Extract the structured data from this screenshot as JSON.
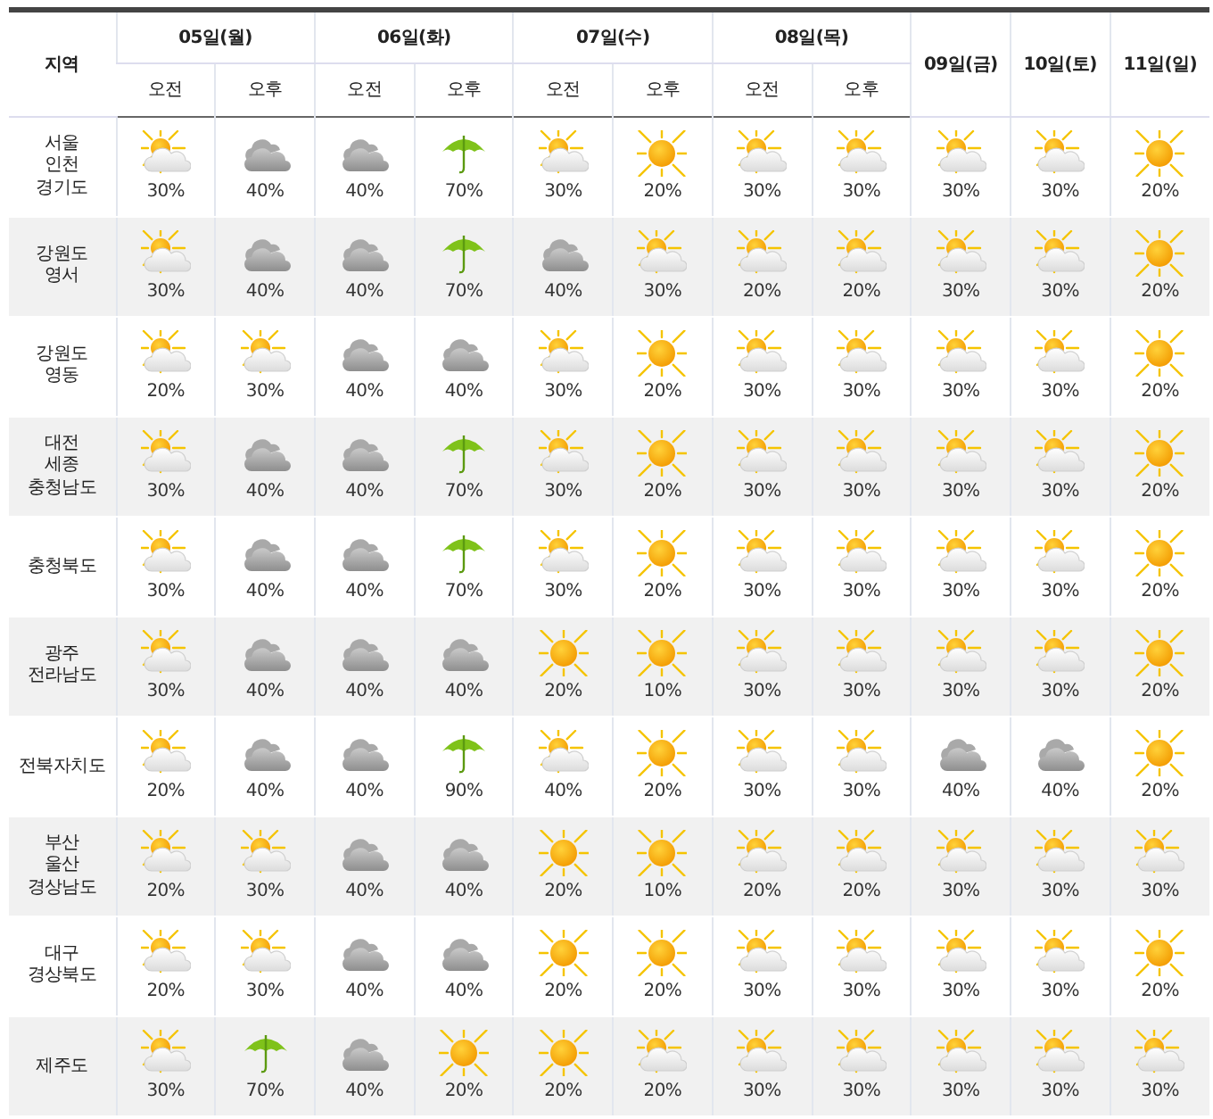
{
  "table": {
    "region_heading": "지역",
    "columns": [
      {
        "day": "05일(월)",
        "periods": [
          "오전",
          "오후"
        ]
      },
      {
        "day": "06일(화)",
        "periods": [
          "오전",
          "오후"
        ]
      },
      {
        "day": "07일(수)",
        "periods": [
          "오전",
          "오후"
        ]
      },
      {
        "day": "08일(목)",
        "periods": [
          "오전",
          "오후"
        ]
      },
      {
        "day": "09일(금)"
      },
      {
        "day": "10일(토)"
      },
      {
        "day": "11일(일)"
      }
    ],
    "rows": [
      {
        "region": "서울\n인천\n경기도",
        "forecasts": [
          {
            "kind": "partly",
            "chance": "30%"
          },
          {
            "kind": "cloudy",
            "chance": "40%"
          },
          {
            "kind": "cloudy",
            "chance": "40%"
          },
          {
            "kind": "rain",
            "chance": "70%"
          },
          {
            "kind": "partly",
            "chance": "30%"
          },
          {
            "kind": "sunny",
            "chance": "20%"
          },
          {
            "kind": "partly",
            "chance": "30%"
          },
          {
            "kind": "partly",
            "chance": "30%"
          },
          {
            "kind": "partly",
            "chance": "30%"
          },
          {
            "kind": "partly",
            "chance": "30%"
          },
          {
            "kind": "sunny",
            "chance": "20%"
          }
        ]
      },
      {
        "region": "강원도\n영서",
        "forecasts": [
          {
            "kind": "partly",
            "chance": "30%"
          },
          {
            "kind": "cloudy",
            "chance": "40%"
          },
          {
            "kind": "cloudy",
            "chance": "40%"
          },
          {
            "kind": "rain",
            "chance": "70%"
          },
          {
            "kind": "cloudy",
            "chance": "40%"
          },
          {
            "kind": "partly",
            "chance": "30%"
          },
          {
            "kind": "partly",
            "chance": "20%"
          },
          {
            "kind": "partly",
            "chance": "20%"
          },
          {
            "kind": "partly",
            "chance": "30%"
          },
          {
            "kind": "partly",
            "chance": "30%"
          },
          {
            "kind": "sunny",
            "chance": "20%"
          }
        ]
      },
      {
        "region": "강원도\n영동",
        "forecasts": [
          {
            "kind": "partly",
            "chance": "20%"
          },
          {
            "kind": "partly",
            "chance": "30%"
          },
          {
            "kind": "cloudy",
            "chance": "40%"
          },
          {
            "kind": "cloudy",
            "chance": "40%"
          },
          {
            "kind": "partly",
            "chance": "30%"
          },
          {
            "kind": "sunny",
            "chance": "20%"
          },
          {
            "kind": "partly",
            "chance": "30%"
          },
          {
            "kind": "partly",
            "chance": "30%"
          },
          {
            "kind": "partly",
            "chance": "30%"
          },
          {
            "kind": "partly",
            "chance": "30%"
          },
          {
            "kind": "sunny",
            "chance": "20%"
          }
        ]
      },
      {
        "region": "대전\n세종\n충청남도",
        "forecasts": [
          {
            "kind": "partly",
            "chance": "30%"
          },
          {
            "kind": "cloudy",
            "chance": "40%"
          },
          {
            "kind": "cloudy",
            "chance": "40%"
          },
          {
            "kind": "rain",
            "chance": "70%"
          },
          {
            "kind": "partly",
            "chance": "30%"
          },
          {
            "kind": "sunny",
            "chance": "20%"
          },
          {
            "kind": "partly",
            "chance": "30%"
          },
          {
            "kind": "partly",
            "chance": "30%"
          },
          {
            "kind": "partly",
            "chance": "30%"
          },
          {
            "kind": "partly",
            "chance": "30%"
          },
          {
            "kind": "sunny",
            "chance": "20%"
          }
        ]
      },
      {
        "region": "충청북도",
        "forecasts": [
          {
            "kind": "partly",
            "chance": "30%"
          },
          {
            "kind": "cloudy",
            "chance": "40%"
          },
          {
            "kind": "cloudy",
            "chance": "40%"
          },
          {
            "kind": "rain",
            "chance": "70%"
          },
          {
            "kind": "partly",
            "chance": "30%"
          },
          {
            "kind": "sunny",
            "chance": "20%"
          },
          {
            "kind": "partly",
            "chance": "30%"
          },
          {
            "kind": "partly",
            "chance": "30%"
          },
          {
            "kind": "partly",
            "chance": "30%"
          },
          {
            "kind": "partly",
            "chance": "30%"
          },
          {
            "kind": "sunny",
            "chance": "20%"
          }
        ]
      },
      {
        "region": "광주\n전라남도",
        "forecasts": [
          {
            "kind": "partly",
            "chance": "30%"
          },
          {
            "kind": "cloudy",
            "chance": "40%"
          },
          {
            "kind": "cloudy",
            "chance": "40%"
          },
          {
            "kind": "cloudy",
            "chance": "40%"
          },
          {
            "kind": "sunny",
            "chance": "20%"
          },
          {
            "kind": "sunny",
            "chance": "10%"
          },
          {
            "kind": "partly",
            "chance": "30%"
          },
          {
            "kind": "partly",
            "chance": "30%"
          },
          {
            "kind": "partly",
            "chance": "30%"
          },
          {
            "kind": "partly",
            "chance": "30%"
          },
          {
            "kind": "sunny",
            "chance": "20%"
          }
        ]
      },
      {
        "region": "전북자치도",
        "forecasts": [
          {
            "kind": "partly",
            "chance": "20%"
          },
          {
            "kind": "cloudy",
            "chance": "40%"
          },
          {
            "kind": "cloudy",
            "chance": "40%"
          },
          {
            "kind": "rain",
            "chance": "90%"
          },
          {
            "kind": "partly",
            "chance": "40%"
          },
          {
            "kind": "sunny",
            "chance": "20%"
          },
          {
            "kind": "partly",
            "chance": "30%"
          },
          {
            "kind": "partly",
            "chance": "30%"
          },
          {
            "kind": "cloudy",
            "chance": "40%"
          },
          {
            "kind": "cloudy",
            "chance": "40%"
          },
          {
            "kind": "sunny",
            "chance": "20%"
          }
        ]
      },
      {
        "region": "부산\n울산\n경상남도",
        "forecasts": [
          {
            "kind": "partly",
            "chance": "20%"
          },
          {
            "kind": "partly",
            "chance": "30%"
          },
          {
            "kind": "cloudy",
            "chance": "40%"
          },
          {
            "kind": "cloudy",
            "chance": "40%"
          },
          {
            "kind": "sunny",
            "chance": "20%"
          },
          {
            "kind": "sunny",
            "chance": "10%"
          },
          {
            "kind": "partly",
            "chance": "20%"
          },
          {
            "kind": "partly",
            "chance": "20%"
          },
          {
            "kind": "partly",
            "chance": "30%"
          },
          {
            "kind": "partly",
            "chance": "30%"
          },
          {
            "kind": "partly",
            "chance": "30%"
          }
        ]
      },
      {
        "region": "대구\n경상북도",
        "forecasts": [
          {
            "kind": "partly",
            "chance": "20%"
          },
          {
            "kind": "partly",
            "chance": "30%"
          },
          {
            "kind": "cloudy",
            "chance": "40%"
          },
          {
            "kind": "cloudy",
            "chance": "40%"
          },
          {
            "kind": "sunny",
            "chance": "20%"
          },
          {
            "kind": "sunny",
            "chance": "20%"
          },
          {
            "kind": "partly",
            "chance": "30%"
          },
          {
            "kind": "partly",
            "chance": "30%"
          },
          {
            "kind": "partly",
            "chance": "30%"
          },
          {
            "kind": "partly",
            "chance": "30%"
          },
          {
            "kind": "sunny",
            "chance": "20%"
          }
        ]
      },
      {
        "region": "제주도",
        "forecasts": [
          {
            "kind": "partly",
            "chance": "30%"
          },
          {
            "kind": "rain",
            "chance": "70%"
          },
          {
            "kind": "cloudy",
            "chance": "40%"
          },
          {
            "kind": "sunny",
            "chance": "20%"
          },
          {
            "kind": "sunny",
            "chance": "20%"
          },
          {
            "kind": "partly",
            "chance": "20%"
          },
          {
            "kind": "partly",
            "chance": "30%"
          },
          {
            "kind": "partly",
            "chance": "30%"
          },
          {
            "kind": "partly",
            "chance": "30%"
          },
          {
            "kind": "partly",
            "chance": "30%"
          },
          {
            "kind": "partly",
            "chance": "30%"
          }
        ]
      }
    ]
  }
}
